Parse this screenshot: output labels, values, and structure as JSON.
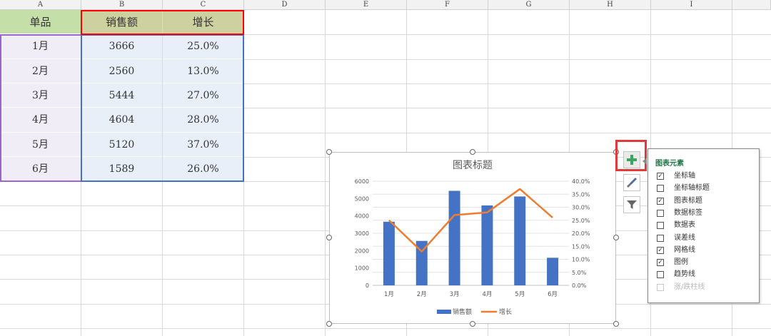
{
  "columns": [
    "A",
    "B",
    "C",
    "D",
    "E",
    "F",
    "G",
    "H",
    "I"
  ],
  "table": {
    "headers": [
      "单品",
      "销售额",
      "增长"
    ],
    "rows": [
      [
        "1月",
        "3666",
        "25.0%"
      ],
      [
        "2月",
        "2560",
        "13.0%"
      ],
      [
        "3月",
        "5444",
        "27.0%"
      ],
      [
        "4月",
        "4604",
        "28.0%"
      ],
      [
        "5月",
        "5120",
        "37.0%"
      ],
      [
        "6月",
        "1589",
        "26.0%"
      ]
    ]
  },
  "colors": {
    "header_a_bg": "#c4dfa7",
    "header_bc_bg": "#cdd19f",
    "col_a_bg": "#f0edf6",
    "col_bc_bg": "#e9eff8",
    "bar": "#4472c4",
    "line": "#ed7d31",
    "sel_red": "#ff0000",
    "sel_blue": "#4472c4",
    "sel_purple": "#9966cc",
    "panel_title": "#217346",
    "plus_btn_border": "#e03a3a"
  },
  "chart_data": {
    "type": "bar",
    "title": "图表标题",
    "categories": [
      "1月",
      "2月",
      "3月",
      "4月",
      "5月",
      "6月"
    ],
    "series": [
      {
        "name": "销售额",
        "type": "bar",
        "axis": "left",
        "values": [
          3666,
          2560,
          5444,
          4604,
          5120,
          1589
        ]
      },
      {
        "name": "增长",
        "type": "line",
        "axis": "right",
        "values": [
          25.0,
          13.0,
          27.0,
          28.0,
          37.0,
          26.0
        ]
      }
    ],
    "ylim": [
      0,
      6000
    ],
    "yticks": [
      "0",
      "1000",
      "2000",
      "3000",
      "4000",
      "5000",
      "6000"
    ],
    "y2lim": [
      0,
      40
    ],
    "y2ticks": [
      "0.0%",
      "5.0%",
      "10.0%",
      "15.0%",
      "20.0%",
      "25.0%",
      "30.0%",
      "35.0%",
      "40.0%"
    ],
    "grid": true,
    "legend_position": "bottom"
  },
  "side_buttons": {
    "plus": "plus-icon",
    "style": "brush-icon",
    "filter": "filter-icon"
  },
  "panel": {
    "title": "图表元素",
    "options": [
      {
        "label": "坐标轴",
        "checked": true,
        "disabled": false
      },
      {
        "label": "坐标轴标题",
        "checked": false,
        "disabled": false
      },
      {
        "label": "图表标题",
        "checked": true,
        "disabled": false
      },
      {
        "label": "数据标签",
        "checked": false,
        "disabled": false
      },
      {
        "label": "数据表",
        "checked": false,
        "disabled": false
      },
      {
        "label": "误差线",
        "checked": false,
        "disabled": false
      },
      {
        "label": "网格线",
        "checked": true,
        "disabled": false
      },
      {
        "label": "图例",
        "checked": true,
        "disabled": false
      },
      {
        "label": "趋势线",
        "checked": false,
        "disabled": false
      },
      {
        "label": "涨/跌柱线",
        "checked": false,
        "disabled": true
      }
    ]
  }
}
